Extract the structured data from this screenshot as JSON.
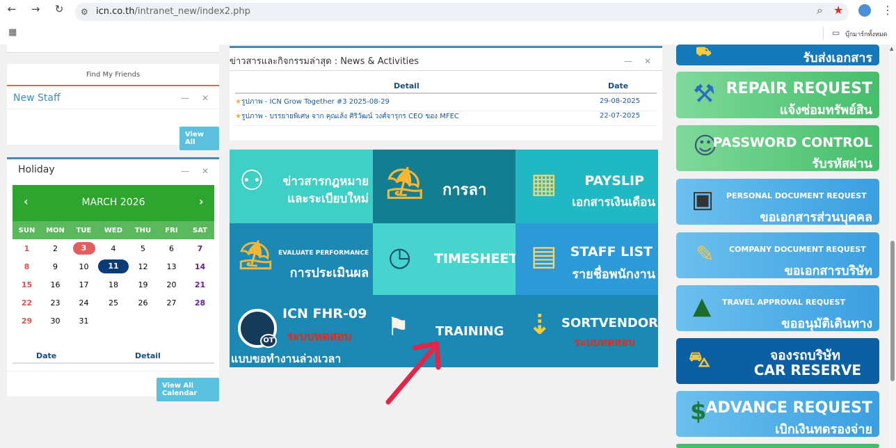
{
  "browser": {
    "url_host": "icn.co.th",
    "url_path": "/intranet_new/index2.php",
    "bookmarks": "บุ๊กมาร์กทั้งหมด"
  },
  "friends": {
    "title": "Find My Friends"
  },
  "newstaff": {
    "title": "New Staff",
    "view_all": "View All"
  },
  "holiday": {
    "title": "Holiday",
    "month": "MARCH 2026",
    "days": [
      "SUN",
      "MON",
      "TUE",
      "WED",
      "THU",
      "FRI",
      "SAT"
    ],
    "date_label": "Date",
    "detail_label": "Detail",
    "view_all": "View All Calendar"
  },
  "news": {
    "title": "ข่าวสารและกิจกรรมล่าสุด : News & Activities",
    "col_detail": "Detail",
    "col_date": "Date",
    "rows": [
      {
        "detail": "รูปภาพ - ICN Grow Together #3 2025-08-29",
        "date": "29-08-2025"
      },
      {
        "detail": "รูปภาพ - บรรยายพิเศษ จาก คุณเล้ง ศิริวัฒน์ วงศ์จารุกร CEO ของ MFEC",
        "date": "22-07-2025"
      }
    ]
  },
  "tiles": {
    "law": {
      "l1": "ข่าวสารกฎหมาย",
      "l2": "และระเบียบใหม่"
    },
    "leave": {
      "l1": "การลา"
    },
    "payslip": {
      "l1": "PAYSLIP",
      "l2": "เอกสารเงินเดือน"
    },
    "evaluate": {
      "l1": "EVALUATE PERFORMANCE",
      "l2": "การประเมินผล"
    },
    "timesheet": {
      "l1": "TIMESHEET"
    },
    "stafflist": {
      "l1": "STAFF LIST",
      "l2": "รายชื่อพนักงาน"
    },
    "fhr": {
      "l1": "ICN FHR-09",
      "l2": "ระบบทดสอบ",
      "l3": "แบบขอทำงานล่วงเวลา",
      "badge": "OT"
    },
    "training": {
      "l1": "TRAINING"
    },
    "sortvendor": {
      "l1": "SORTVENDOR",
      "l2": "ระบบทดสอบ"
    }
  },
  "side": {
    "document": {
      "l2": "รับส่งเอกสาร"
    },
    "repair": {
      "l1": "REPAIR REQUEST",
      "l2": "แจ้งซ่อมทรัพย์สิน"
    },
    "password": {
      "l1": "PASSWORD CONTROL",
      "l2": "รับรหัสผ่าน"
    },
    "personal": {
      "l1": "PERSONAL DOCUMENT REQUEST",
      "l2": "ขอเอกสารส่วนบุคคล"
    },
    "company": {
      "l1": "COMPANY DOCUMENT REQUEST",
      "l2": "ขอเอกสารบริษัท"
    },
    "travel": {
      "l1": "TRAVEL APPROVAL REQUEST",
      "l2": "ขออนุมัติเดินทาง"
    },
    "car": {
      "l1": "จองรถบริษัท",
      "l2": "CAR RESERVE"
    },
    "advance": {
      "l1": "ADVANCE REQUEST",
      "l2": "เบิกเงินทดรองจ่าย"
    }
  }
}
